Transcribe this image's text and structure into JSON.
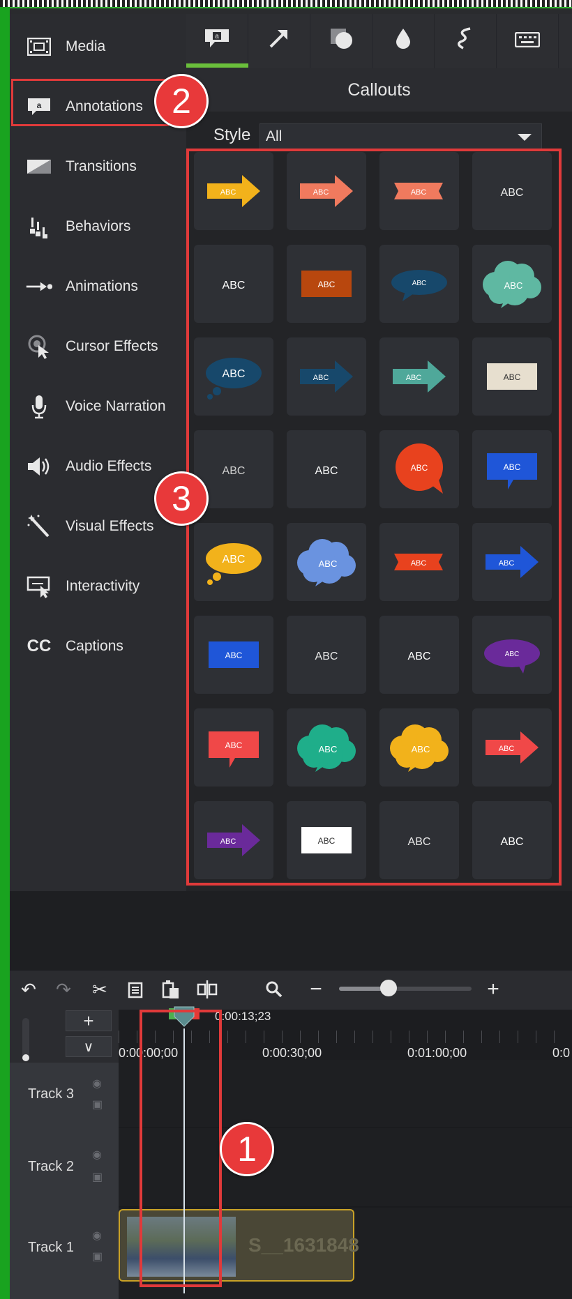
{
  "nav": {
    "items": [
      {
        "label": "Media",
        "icon": "film-strip-icon"
      },
      {
        "label": "Annotations",
        "icon": "annotation-icon"
      },
      {
        "label": "Transitions",
        "icon": "transition-icon"
      },
      {
        "label": "Behaviors",
        "icon": "behaviors-icon"
      },
      {
        "label": "Animations",
        "icon": "animation-arrow-icon"
      },
      {
        "label": "Cursor Effects",
        "icon": "cursor-effects-icon"
      },
      {
        "label": "Voice Narration",
        "icon": "microphone-icon"
      },
      {
        "label": "Audio Effects",
        "icon": "speaker-icon"
      },
      {
        "label": "Visual Effects",
        "icon": "magic-wand-icon"
      },
      {
        "label": "Interactivity",
        "icon": "interactivity-icon"
      },
      {
        "label": "Captions",
        "icon": "cc-icon"
      }
    ]
  },
  "annotation_tabs": [
    "callout-icon",
    "arrow-icon",
    "shape-icon",
    "blur-drop-icon",
    "sketch-motion-icon",
    "keyboard-icon"
  ],
  "panel": {
    "title": "Callouts",
    "style_label": "Style",
    "style_value": "All"
  },
  "callouts": [
    {
      "kind": "arrow",
      "color": "#f2b21b",
      "text": "ABC"
    },
    {
      "kind": "arrow",
      "color": "#f07a5e",
      "text": "ABC"
    },
    {
      "kind": "banner",
      "color": "#f07a5e",
      "text": "ABC"
    },
    {
      "kind": "text",
      "color": "#e8e8e8",
      "text": "ABC"
    },
    {
      "kind": "text",
      "color": "#ffffff",
      "text": "ABC"
    },
    {
      "kind": "rect",
      "color": "#b8470e",
      "text": "ABC"
    },
    {
      "kind": "oval",
      "color": "#17486b",
      "text": "ABC"
    },
    {
      "kind": "cloud",
      "color": "#5fb8a2",
      "text": "ABC"
    },
    {
      "kind": "thought-oval",
      "color": "#17486b",
      "text": "ABC"
    },
    {
      "kind": "arrow",
      "color": "#17486b",
      "text": "ABC"
    },
    {
      "kind": "arrow",
      "color": "#4fa89a",
      "text": "ABC"
    },
    {
      "kind": "rect",
      "color": "#e7dfcf",
      "text": "ABC"
    },
    {
      "kind": "text",
      "color": "#d0d0d0",
      "text": "ABC"
    },
    {
      "kind": "text",
      "color": "#ffffff",
      "text": "ABC"
    },
    {
      "kind": "circle-speech",
      "color": "#e8421e",
      "text": "ABC"
    },
    {
      "kind": "speech-rect",
      "color": "#1f56d8",
      "text": "ABC"
    },
    {
      "kind": "thought-oval",
      "color": "#f2b21b",
      "text": "ABC"
    },
    {
      "kind": "cloud",
      "color": "#6a93e0",
      "text": "ABC"
    },
    {
      "kind": "banner",
      "color": "#e8421e",
      "text": "ABC"
    },
    {
      "kind": "arrow",
      "color": "#1f56d8",
      "text": "ABC"
    },
    {
      "kind": "rect",
      "color": "#1f56d8",
      "text": "ABC"
    },
    {
      "kind": "text",
      "color": "#e8e8e8",
      "text": "ABC"
    },
    {
      "kind": "text",
      "color": "#ffffff",
      "text": "ABC"
    },
    {
      "kind": "speech-oval",
      "color": "#6a2a9a",
      "text": "ABC"
    },
    {
      "kind": "speech-rect",
      "color": "#f04848",
      "text": "ABC"
    },
    {
      "kind": "cloud",
      "color": "#1fae8a",
      "text": "ABC"
    },
    {
      "kind": "cloud",
      "color": "#f2b21b",
      "text": "ABC"
    },
    {
      "kind": "arrow",
      "color": "#f04848",
      "text": "ABC"
    },
    {
      "kind": "arrow",
      "color": "#6a2a9a",
      "text": "ABC"
    },
    {
      "kind": "rect",
      "color": "#ffffff",
      "text": "ABC"
    },
    {
      "kind": "text",
      "color": "#e8e8e8",
      "text": "ABC"
    },
    {
      "kind": "text",
      "color": "#ffffff",
      "text": "ABC"
    }
  ],
  "timeline": {
    "time_readout": "0:00:13;23",
    "ticks": [
      "0:00:00;00",
      "0:00:30;00",
      "0:01:00;00",
      "0:0"
    ],
    "tracks": [
      {
        "name": "Track 3"
      },
      {
        "name": "Track 2"
      },
      {
        "name": "Track 1"
      }
    ],
    "clip_name": "S__1631848",
    "zoom_level": 0.37
  },
  "badges": {
    "one": "1",
    "two": "2",
    "three": "3"
  },
  "colors": {
    "highlight": "#e03a3a",
    "accent_green": "#6abf3b",
    "badge_red": "#e8393a"
  }
}
